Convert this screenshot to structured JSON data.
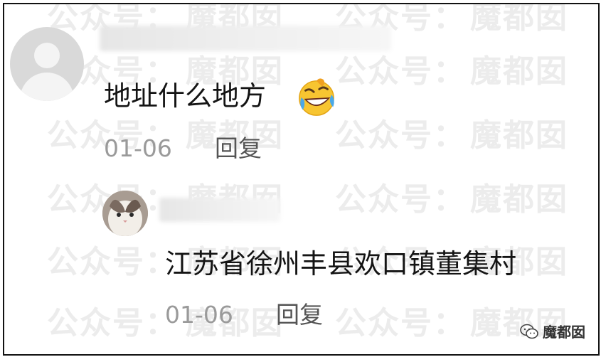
{
  "watermark": {
    "text_a": "公众号：",
    "text_b": "魔都囡"
  },
  "comment": {
    "text": "地址什么地方",
    "emoji_icon": "rolling-laughing-face-icon",
    "date": "01-06",
    "reply_label": "回复"
  },
  "reply_comment": {
    "text": "江苏省徐州丰县欢口镇董集村",
    "date": "01-06",
    "reply_label": "回复"
  },
  "brand": {
    "name": "魔都囡",
    "icon": "wechat-icon"
  }
}
